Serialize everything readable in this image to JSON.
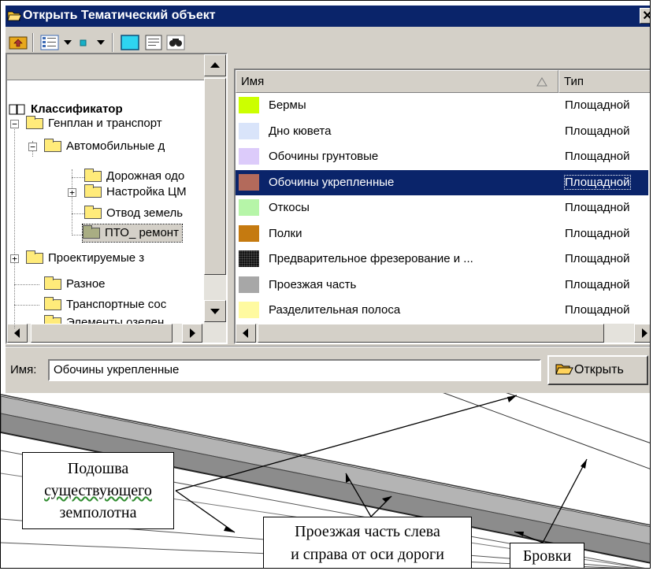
{
  "dialog": {
    "title": "Открыть Тематический объект",
    "close_glyph": "✕",
    "toolbar_icons": [
      "folder-up-icon",
      "view-list-icon",
      "dropdown-arrow-icon",
      "small-square-icon",
      "dropdown-arrow-icon",
      "preview-icon",
      "details-icon",
      "find-icon"
    ],
    "tree": {
      "root": "Классификатор",
      "items": [
        "Генплан и транспорт",
        "Автомобильные д",
        "Дорожная одо",
        "Настройка ЦМ",
        "Отвод земель",
        "ПТО_ ремонт",
        "Проектируемые з",
        "Разное",
        "Транспортные сос",
        "Элементы озелен"
      ]
    },
    "list": {
      "headers": {
        "name": "Имя",
        "type": "Тип"
      },
      "rows": [
        {
          "name": "Бермы",
          "type": "Площадной",
          "color": "#ccff00"
        },
        {
          "name": "Дно кювета",
          "type": "Площадной",
          "color": "#d9e4fa"
        },
        {
          "name": "Обочины грунтовые",
          "type": "Площадной",
          "color": "#dccbfa"
        },
        {
          "name": "Обочины укрепленные",
          "type": "Площадной",
          "color": "#b36a5b"
        },
        {
          "name": "Откосы",
          "type": "Площадной",
          "color": "#b6f5a8"
        },
        {
          "name": "Полки",
          "type": "Площадной",
          "color": "#c57a10"
        },
        {
          "name": "Предварительное фрезерование и ...",
          "type": "Площадной",
          "color": "#111111"
        },
        {
          "name": "Проезжая часть",
          "type": "Площадной",
          "color": "#a7a7a7"
        },
        {
          "name": "Разделительная полоса",
          "type": "Площадной",
          "color": "#fffaa0"
        }
      ]
    },
    "name_label": "Имя:",
    "name_value": "Обочины укрепленные",
    "open_button": "Открыть"
  },
  "annotations": {
    "subgrade": [
      "Подошва",
      "существующего",
      "земполотна"
    ],
    "carriageway": [
      "Проезжая часть слева",
      "и справа от оси дороги"
    ],
    "edges": "Бровки"
  },
  "colors": {
    "titlebar": "#0a246a",
    "selection": "#0a246a",
    "dialog_face": "#d4d0c8",
    "road_dark": "#8c8c8c",
    "road_light": "#b4b4b4"
  }
}
